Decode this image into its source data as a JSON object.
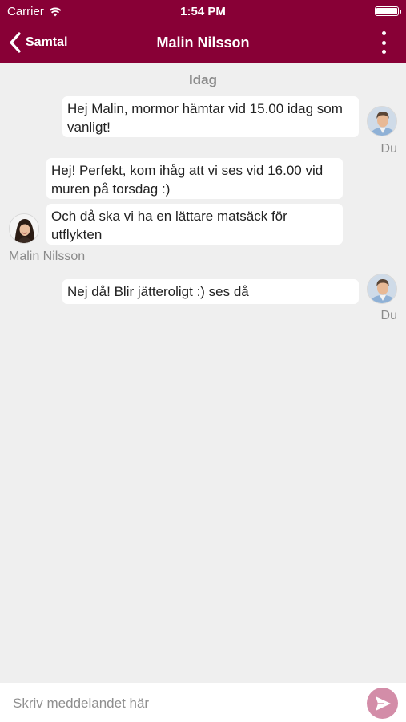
{
  "status_bar": {
    "carrier": "Carrier",
    "time": "1:54 PM"
  },
  "nav": {
    "back_label": "Samtal",
    "title": "Malin Nilsson"
  },
  "conversation": {
    "day_label": "Idag",
    "messages": [
      {
        "sender": "Du",
        "text": "Hej Malin, mormor hämtar vid 15.00 idag som vanligt!"
      },
      {
        "sender": "",
        "text": "Hej! Perfekt, kom ihåg att vi ses vid 16.00 vid muren på torsdag :)"
      },
      {
        "sender": "Malin Nilsson",
        "text": "Och då ska vi ha en lättare matsäck för utflykten"
      },
      {
        "sender": "Du",
        "text": "Nej då! Blir jätteroligt :) ses då"
      }
    ]
  },
  "composer": {
    "placeholder": "Skriv meddelandet här",
    "value": ""
  },
  "colors": {
    "brand": "#880036",
    "send_button": "#d38da8",
    "background": "#efefef"
  },
  "icons": [
    "wifi-icon",
    "battery-icon",
    "back-chevron-icon",
    "more-vertical-icon",
    "send-icon"
  ]
}
